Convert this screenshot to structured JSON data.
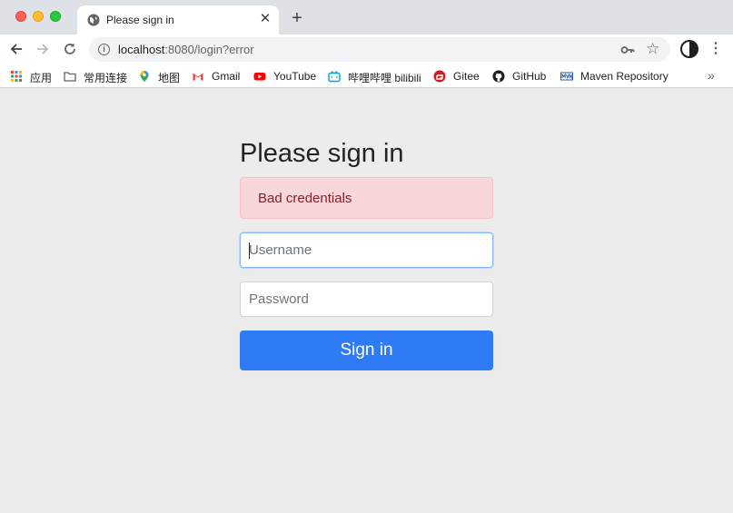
{
  "window": {
    "tab_title": "Please sign in",
    "new_tab_symbol": "+",
    "close_tab_symbol": "✕"
  },
  "toolbar": {
    "url_host": "localhost",
    "url_rest": ":8080/login?error"
  },
  "bookmarks": {
    "items": [
      {
        "label": "应用",
        "icon": "apps-grid-icon"
      },
      {
        "label": "常用连接",
        "icon": "folder-icon"
      },
      {
        "label": "地图",
        "icon": "maps-pin-icon"
      },
      {
        "label": "Gmail",
        "icon": "gmail-icon"
      },
      {
        "label": "YouTube",
        "icon": "youtube-icon"
      },
      {
        "label": "哔哩哔哩 bilibili",
        "icon": "bilibili-icon"
      },
      {
        "label": "Gitee",
        "icon": "gitee-icon"
      },
      {
        "label": "GitHub",
        "icon": "github-icon"
      },
      {
        "label": "Maven Repository",
        "icon": "maven-icon"
      }
    ],
    "more_symbol": "»"
  },
  "page": {
    "heading": "Please sign in",
    "alert": "Bad credentials",
    "username_placeholder": "Username",
    "password_placeholder": "Password",
    "submit_label": "Sign in"
  },
  "colors": {
    "primary": "#2f7bf5",
    "alert_bg": "#f8d7da",
    "alert_text": "#842029",
    "page_bg": "#ececec"
  }
}
